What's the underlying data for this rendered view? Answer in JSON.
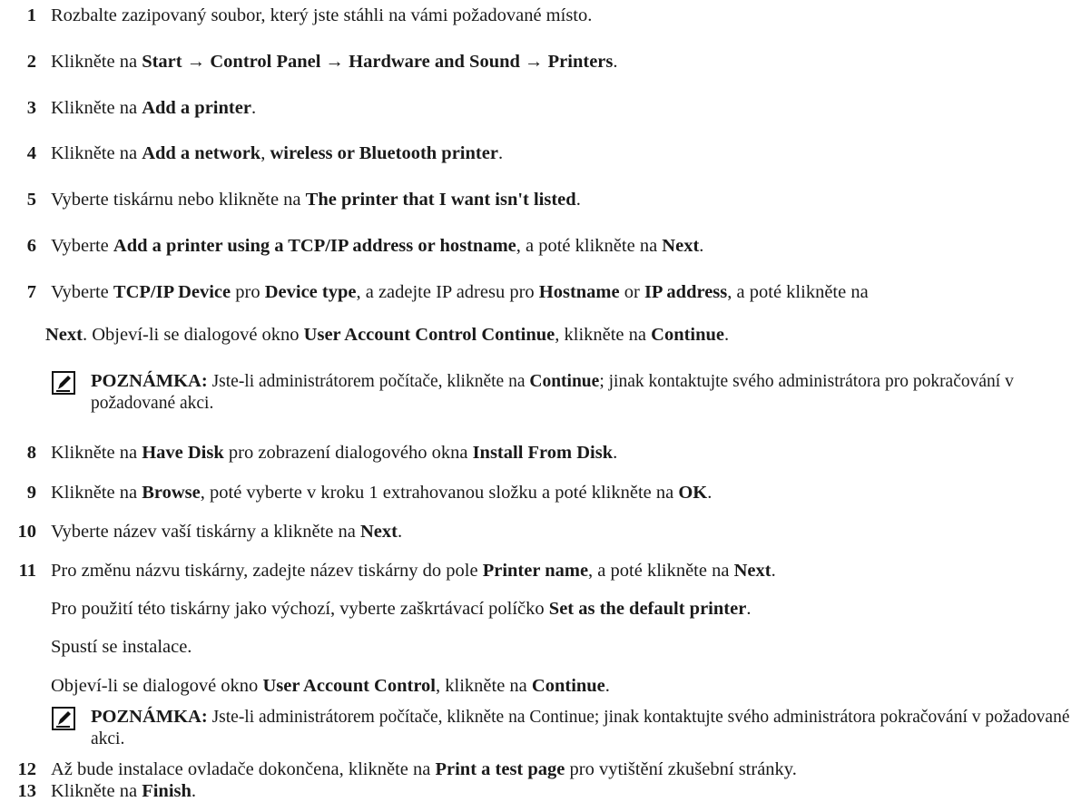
{
  "steps": [
    {
      "num": "1",
      "segments": [
        {
          "t": "Rozbalte zazipovaný soubor, který jste stáhli na vámi požadované místo.",
          "b": false
        }
      ]
    },
    {
      "num": "2",
      "segments": [
        {
          "t": "Klikněte na ",
          "b": false
        },
        {
          "t": "Start",
          "b": true
        },
        {
          "t": " → ",
          "b": false
        },
        {
          "t": "Control Panel",
          "b": true
        },
        {
          "t": " → ",
          "b": false
        },
        {
          "t": "Hardware and Sound",
          "b": true
        },
        {
          "t": " → ",
          "b": false
        },
        {
          "t": "Printers",
          "b": true
        },
        {
          "t": ".",
          "b": false
        }
      ]
    },
    {
      "num": "3",
      "segments": [
        {
          "t": "Klikněte na ",
          "b": false
        },
        {
          "t": "Add a printer",
          "b": true
        },
        {
          "t": ".",
          "b": false
        }
      ]
    },
    {
      "num": "4",
      "segments": [
        {
          "t": "Klikněte na ",
          "b": false
        },
        {
          "t": "Add a network",
          "b": true
        },
        {
          "t": ", ",
          "b": false
        },
        {
          "t": "wireless or Bluetooth printer",
          "b": true
        },
        {
          "t": ".",
          "b": false
        }
      ]
    },
    {
      "num": "5",
      "segments": [
        {
          "t": "Vyberte tiskárnu nebo klikněte na ",
          "b": false
        },
        {
          "t": "The printer that I want isn't listed",
          "b": true
        },
        {
          "t": ".",
          "b": false
        }
      ]
    },
    {
      "num": "6",
      "segments": [
        {
          "t": "Vyberte ",
          "b": false
        },
        {
          "t": "Add a printer using a TCP/IP address or hostname",
          "b": true
        },
        {
          "t": ", a poté klikněte na ",
          "b": false
        },
        {
          "t": "Next",
          "b": true
        },
        {
          "t": ".",
          "b": false
        }
      ]
    },
    {
      "num": "7",
      "segments": [
        {
          "t": "Vyberte ",
          "b": false
        },
        {
          "t": "TCP/IP Device",
          "b": true
        },
        {
          "t": " pro ",
          "b": false
        },
        {
          "t": "Device type",
          "b": true
        },
        {
          "t": ", a zadejte IP adresu pro ",
          "b": false
        },
        {
          "t": "Hostname",
          "b": true
        },
        {
          "t": " or ",
          "b": false
        },
        {
          "t": "IP address",
          "b": true
        },
        {
          "t": ", a poté klikněte na",
          "b": false
        }
      ]
    },
    {
      "num": "",
      "segments": [
        {
          "t": "Next",
          "b": true
        },
        {
          "t": ". Objeví-li se dialogové okno ",
          "b": false
        },
        {
          "t": "User Account Control Continue",
          "b": true
        },
        {
          "t": ", klikněte na ",
          "b": false
        },
        {
          "t": "Continue",
          "b": true
        },
        {
          "t": ".",
          "b": false
        }
      ]
    },
    {
      "num": "8",
      "segments": [
        {
          "t": "Klikněte na ",
          "b": false
        },
        {
          "t": "Have Disk",
          "b": true
        },
        {
          "t": " pro zobrazení dialogového okna ",
          "b": false
        },
        {
          "t": "Install From Disk",
          "b": true
        },
        {
          "t": ".",
          "b": false
        }
      ]
    },
    {
      "num": "9",
      "segments": [
        {
          "t": "Klikněte na ",
          "b": false
        },
        {
          "t": "Browse",
          "b": true
        },
        {
          "t": ", poté vyberte v kroku 1 extrahovanou složku a poté klikněte na ",
          "b": false
        },
        {
          "t": "OK",
          "b": true
        },
        {
          "t": ".",
          "b": false
        }
      ]
    },
    {
      "num": "10",
      "segments": [
        {
          "t": "Vyberte název vaší tiskárny a klikněte na ",
          "b": false
        },
        {
          "t": "Next",
          "b": true
        },
        {
          "t": ".",
          "b": false
        }
      ]
    },
    {
      "num": "11",
      "segments": [
        {
          "t": "Pro změnu názvu tiskárny, zadejte název tiskárny do pole ",
          "b": false
        },
        {
          "t": "Printer name",
          "b": true
        },
        {
          "t": ", a poté klikněte na ",
          "b": false
        },
        {
          "t": "Next",
          "b": true
        },
        {
          "t": ".",
          "b": false
        }
      ]
    },
    {
      "num": "",
      "segments": [
        {
          "t": "Pro použití této tiskárny jako výchozí, vyberte zaškrtávací políčko ",
          "b": false
        },
        {
          "t": "Set as the default printer",
          "b": true
        },
        {
          "t": ".",
          "b": false
        }
      ]
    },
    {
      "num": "",
      "segments": [
        {
          "t": "Spustí se instalace.",
          "b": false
        }
      ]
    },
    {
      "num": "",
      "segments": [
        {
          "t": "Objeví-li se dialogové okno ",
          "b": false
        },
        {
          "t": "User Account Control",
          "b": true
        },
        {
          "t": ", klikněte na ",
          "b": false
        },
        {
          "t": "Continue",
          "b": true
        },
        {
          "t": ".",
          "b": false
        }
      ]
    },
    {
      "num": "12",
      "segments": [
        {
          "t": "Až bude instalace ovladače dokončena, klikněte na ",
          "b": false
        },
        {
          "t": "Print a test page",
          "b": true
        },
        {
          "t": " pro vytištění zkušební stránky.",
          "b": false
        }
      ]
    },
    {
      "num": "13",
      "segments": [
        {
          "t": "Klikněte na ",
          "b": false
        },
        {
          "t": "Finish",
          "b": true
        },
        {
          "t": ".",
          "b": false
        }
      ]
    }
  ],
  "notes": [
    {
      "label": "POZNÁMKA:",
      "segments": [
        {
          "t": " Jste-li administrátorem počítače, klikněte na ",
          "b": false
        },
        {
          "t": "Continue",
          "b": true
        },
        {
          "t": "; jinak kontaktujte svého administrátora pro pokračování v požadované akci.",
          "b": false
        }
      ]
    },
    {
      "label": "POZNÁMKA:",
      "segments": [
        {
          "t": " Jste-li administrátorem počítače, klikněte na Continue; jinak kontaktujte svého administrátora pokračování v požadované akci.",
          "b": false
        }
      ]
    }
  ]
}
